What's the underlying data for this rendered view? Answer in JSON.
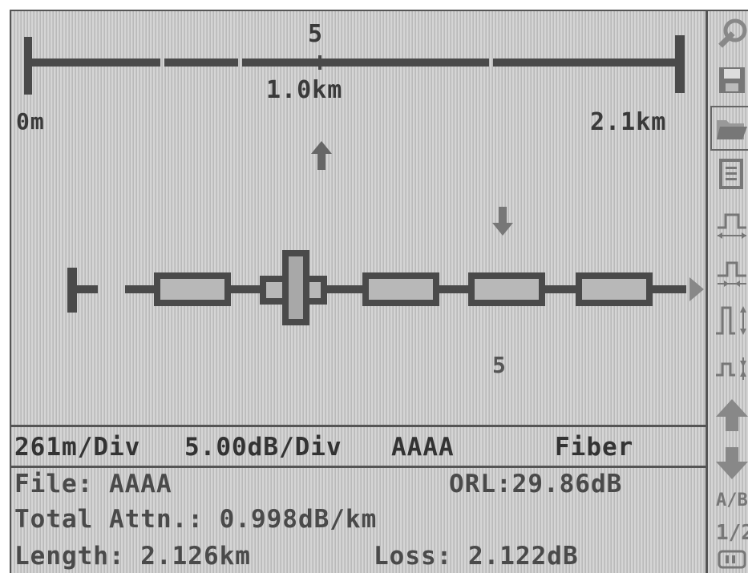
{
  "trace": {
    "ruler_event_marker": "5",
    "ruler_mid_label": "1.0km",
    "ruler_start_label": "0m",
    "ruler_end_label": "2.1km",
    "event_marker": "5"
  },
  "info_bar": {
    "scale_h": "261m/Div",
    "scale_v": "5.00dB/Div",
    "file_id": "AAAA",
    "mode": "Fiber"
  },
  "status": {
    "file_label": "File: AAAA",
    "orl_label": "ORL:29.86dB",
    "attn_label": "Total Attn.: 0.998dB/km",
    "length_label": "Length: 2.126km",
    "loss_label": "Loss: 2.122dB"
  },
  "toolbar": {
    "icons": [
      "wrench-icon",
      "save-icon",
      "open-folder-icon",
      "document-icon",
      "pulse-expand-icon",
      "pulse-compress-icon",
      "pulse-vertical-expand-icon",
      "pulse-vertical-compress-icon",
      "arrow-up-icon",
      "arrow-down-icon"
    ],
    "ab_label": "A/B",
    "page_label": "1/2"
  },
  "colors": {
    "screen_bg": "#cfcfcf",
    "ink": "#4a4a4a",
    "arrow": "#777777"
  }
}
